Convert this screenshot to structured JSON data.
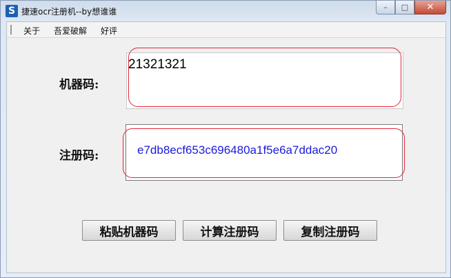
{
  "window": {
    "title": "捷速ocr注册机--by想谁谁",
    "icon_letter": "S",
    "controls": {
      "minimize": "–",
      "maximize": "□",
      "close": "✕"
    }
  },
  "menu": {
    "items": [
      "关于",
      "吾爱破解",
      "好评"
    ]
  },
  "form": {
    "machine_code_label": "机器码:",
    "machine_code_value": "21321321",
    "reg_code_label": "注册码:",
    "reg_code_value": "e7db8ecf653c696480a1f5e6a7ddac20"
  },
  "buttons": {
    "paste": "粘贴机器码",
    "calculate": "计算注册码",
    "copy": "复制注册码"
  },
  "colors": {
    "reg_code_text": "#1a1adc",
    "highlight_ring": "#e0263a"
  }
}
